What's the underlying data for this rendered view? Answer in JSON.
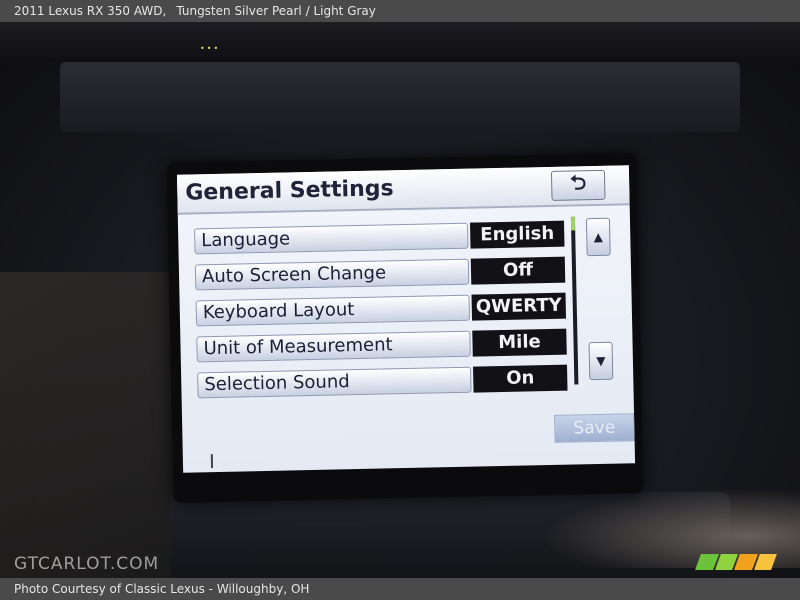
{
  "caption": {
    "vehicle": "2011 Lexus RX 350 AWD,",
    "colors": "Tungsten Silver Pearl / Light Gray"
  },
  "footer": {
    "credit": "Photo Courtesy of Classic Lexus - Willoughby, OH"
  },
  "watermark": "GTCARLOT.COM",
  "screen": {
    "title": "General Settings",
    "back_icon": "return-arrow",
    "rows": [
      {
        "label": "Language",
        "value": "English"
      },
      {
        "label": "Auto Screen Change",
        "value": "Off"
      },
      {
        "label": "Keyboard Layout",
        "value": "QWERTY"
      },
      {
        "label": "Unit of Measurement",
        "value": "Mile"
      },
      {
        "label": "Selection Sound",
        "value": "On"
      }
    ],
    "scroll_up_icon": "scroll-up",
    "scroll_down_icon": "scroll-down",
    "save_label": "Save"
  },
  "logo_colors": [
    "#6cc23a",
    "#8fd33e",
    "#f0a21e",
    "#f7c23c"
  ]
}
